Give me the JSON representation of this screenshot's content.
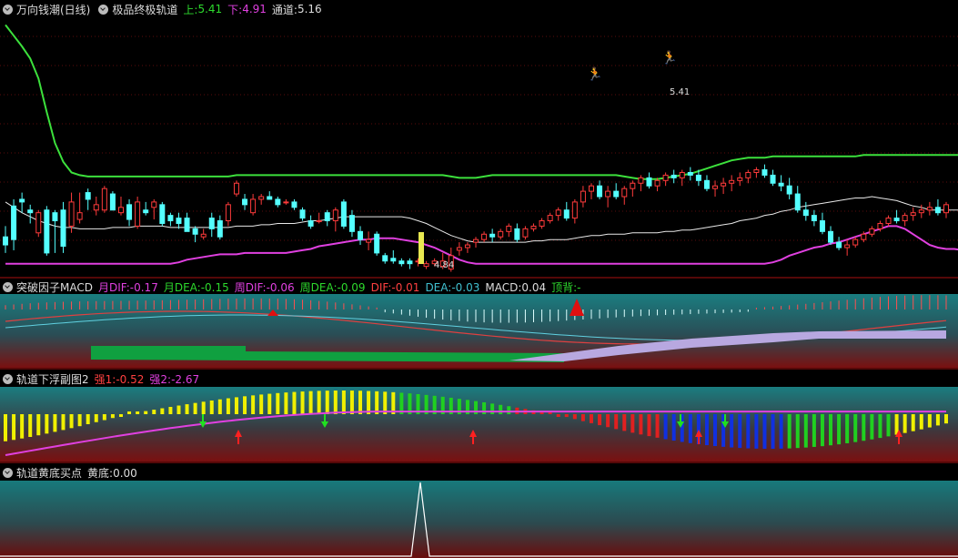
{
  "panel1": {
    "stock_title": "万向钱潮(日线)",
    "indicator_title": "极品终极轨道",
    "up_label": "上:",
    "up_value": "5.41",
    "down_label": "下:",
    "down_value": "4.91",
    "channel_label": "通道:",
    "channel_value": "5.16",
    "high_annotation": "5.41",
    "low_annotation": "4.84"
  },
  "panel2": {
    "title": "突破因子MACD",
    "items": [
      {
        "label": "月DIF:",
        "value": "-0.17",
        "color": "#e040e0"
      },
      {
        "label": "月DEA:",
        "value": "-0.15",
        "color": "#2dd92d"
      },
      {
        "label": "周DIF:",
        "value": "-0.06",
        "color": "#e040e0"
      },
      {
        "label": "周DEA:",
        "value": "-0.09",
        "color": "#2dd92d"
      },
      {
        "label": "DIF:",
        "value": "-0.01",
        "color": "#ff4040"
      },
      {
        "label": "DEA:",
        "value": "-0.03",
        "color": "#40c0d0"
      },
      {
        "label": "MACD:",
        "value": "0.04",
        "color": "#dddddd"
      },
      {
        "label": "顶背:",
        "value": "-",
        "color": "#2dd92d"
      }
    ]
  },
  "panel3": {
    "title": "轨道下浮副图2",
    "items": [
      {
        "label": "强1:",
        "value": "-0.52",
        "color": "#ff4040"
      },
      {
        "label": "强2:",
        "value": "-2.67",
        "color": "#e040e0"
      }
    ]
  },
  "panel4": {
    "title": "轨道黄底买点",
    "items": [
      {
        "label": "黄底:",
        "value": "0.00",
        "color": "#dddddd"
      }
    ]
  },
  "chart_data": {
    "type": "candlestick",
    "colors": {
      "up": "#ff3b3b",
      "down": "#54ffff",
      "upper_band": "#3ce03c",
      "lower_band": "#e040e0",
      "mid_line": "#e8e8e8"
    },
    "upper_band": [
      6.6,
      6.52,
      6.44,
      6.35,
      6.2,
      5.95,
      5.72,
      5.58,
      5.5,
      5.48,
      5.47,
      5.47,
      5.47,
      5.47,
      5.47,
      5.47,
      5.47,
      5.47,
      5.47,
      5.47,
      5.47,
      5.47,
      5.47,
      5.47,
      5.47,
      5.47,
      5.47,
      5.47,
      5.48,
      5.48,
      5.48,
      5.48,
      5.48,
      5.48,
      5.48,
      5.48,
      5.48,
      5.48,
      5.48,
      5.48,
      5.48,
      5.48,
      5.48,
      5.48,
      5.48,
      5.48,
      5.48,
      5.48,
      5.48,
      5.48,
      5.48,
      5.48,
      5.48,
      5.48,
      5.47,
      5.46,
      5.46,
      5.46,
      5.47,
      5.48,
      5.48,
      5.48,
      5.48,
      5.48,
      5.48,
      5.48,
      5.48,
      5.48,
      5.48,
      5.48,
      5.48,
      5.48,
      5.48,
      5.48,
      5.48,
      5.47,
      5.46,
      5.45,
      5.45,
      5.45,
      5.46,
      5.47,
      5.48,
      5.49,
      5.51,
      5.53,
      5.55,
      5.57,
      5.59,
      5.6,
      5.61,
      5.61,
      5.61,
      5.62,
      5.62,
      5.62,
      5.62,
      5.62,
      5.62,
      5.62,
      5.62,
      5.62,
      5.62,
      5.62,
      5.63,
      5.63,
      5.63,
      5.63,
      5.63,
      5.63,
      5.63,
      5.63,
      5.63,
      5.63,
      5.63,
      5.63,
      5.63,
      5.63,
      5.63,
      5.63,
      5.63,
      5.63,
      5.63,
      5.63,
      5.63
    ],
    "mid_line": [
      5.28,
      5.24,
      5.2,
      5.17,
      5.14,
      5.12,
      5.1,
      5.09,
      5.09,
      5.08,
      5.08,
      5.08,
      5.08,
      5.09,
      5.09,
      5.09,
      5.1,
      5.1,
      5.1,
      5.1,
      5.09,
      5.09,
      5.09,
      5.09,
      5.09,
      5.09,
      5.09,
      5.09,
      5.1,
      5.1,
      5.1,
      5.11,
      5.11,
      5.12,
      5.12,
      5.12,
      5.13,
      5.14,
      5.14,
      5.15,
      5.16,
      5.17,
      5.17,
      5.17,
      5.17,
      5.17,
      5.17,
      5.17,
      5.17,
      5.16,
      5.14,
      5.12,
      5.09,
      5.06,
      5.03,
      5.01,
      4.99,
      4.98,
      4.98,
      4.98,
      4.98,
      4.98,
      4.98,
      4.98,
      4.99,
      4.99,
      5.0,
      5.0,
      5.0,
      5.01,
      5.02,
      5.03,
      5.03,
      5.04,
      5.04,
      5.04,
      5.05,
      5.05,
      5.05,
      5.05,
      5.06,
      5.06,
      5.07,
      5.07,
      5.08,
      5.09,
      5.1,
      5.11,
      5.12,
      5.14,
      5.15,
      5.16,
      5.18,
      5.19,
      5.21,
      5.22,
      5.24,
      5.25,
      5.26,
      5.27,
      5.28,
      5.29,
      5.3,
      5.31,
      5.31,
      5.32,
      5.31,
      5.3,
      5.29,
      5.27,
      5.25,
      5.24,
      5.22,
      5.22,
      5.22,
      5.22,
      5.22,
      5.22,
      5.22,
      5.22,
      5.22,
      5.22,
      5.22,
      5.22,
      5.22
    ],
    "lower_band": [
      4.82,
      4.82,
      4.82,
      4.82,
      4.82,
      4.82,
      4.82,
      4.82,
      4.82,
      4.82,
      4.82,
      4.82,
      4.82,
      4.82,
      4.82,
      4.82,
      4.82,
      4.82,
      4.82,
      4.82,
      4.82,
      4.83,
      4.85,
      4.86,
      4.87,
      4.88,
      4.89,
      4.89,
      4.89,
      4.9,
      4.9,
      4.9,
      4.9,
      4.9,
      4.9,
      4.91,
      4.92,
      4.93,
      4.95,
      4.96,
      4.97,
      4.98,
      4.99,
      5.0,
      5.0,
      5.01,
      5.01,
      5.01,
      5.0,
      4.99,
      4.98,
      4.96,
      4.94,
      4.91,
      4.88,
      4.85,
      4.83,
      4.82,
      4.82,
      4.82,
      4.82,
      4.82,
      4.82,
      4.82,
      4.82,
      4.82,
      4.82,
      4.82,
      4.82,
      4.82,
      4.82,
      4.82,
      4.82,
      4.82,
      4.82,
      4.82,
      4.82,
      4.82,
      4.82,
      4.82,
      4.82,
      4.82,
      4.82,
      4.82,
      4.82,
      4.82,
      4.82,
      4.82,
      4.82,
      4.82,
      4.82,
      4.82,
      4.82,
      4.83,
      4.85,
      4.88,
      4.9,
      4.92,
      4.94,
      4.95,
      4.97,
      4.98,
      5.0,
      5.02,
      5.04,
      5.06,
      5.08,
      5.1,
      5.1,
      5.08,
      5.04,
      5.0,
      4.96,
      4.94,
      4.93,
      4.93,
      4.92,
      4.92,
      4.92,
      4.91,
      4.91,
      4.91,
      4.91,
      4.91,
      4.91
    ],
    "ohlc": [
      [
        5.02,
        5.1,
        4.9,
        4.96
      ],
      [
        5.25,
        5.3,
        4.92,
        5.0
      ],
      [
        5.3,
        5.35,
        5.2,
        5.28
      ],
      [
        5.22,
        5.26,
        5.12,
        5.2
      ],
      [
        5.05,
        5.22,
        5.02,
        5.2
      ],
      [
        5.22,
        5.25,
        4.88,
        4.9
      ],
      [
        5.2,
        5.22,
        4.9,
        5.14
      ],
      [
        5.22,
        5.28,
        4.9,
        4.95
      ],
      [
        5.1,
        5.35,
        5.05,
        5.28
      ],
      [
        5.15,
        5.35,
        5.12,
        5.2
      ],
      [
        5.35,
        5.38,
        5.22,
        5.3
      ],
      [
        5.22,
        5.32,
        5.18,
        5.26
      ],
      [
        5.22,
        5.4,
        5.2,
        5.38
      ],
      [
        5.34,
        5.36,
        5.22,
        5.22
      ],
      [
        5.2,
        5.32,
        5.18,
        5.24
      ],
      [
        5.26,
        5.3,
        5.1,
        5.15
      ],
      [
        5.1,
        5.32,
        5.08,
        5.28
      ],
      [
        5.22,
        5.28,
        5.18,
        5.2
      ],
      [
        5.24,
        5.3,
        5.15,
        5.28
      ],
      [
        5.26,
        5.28,
        5.1,
        5.12
      ],
      [
        5.18,
        5.2,
        5.1,
        5.14
      ],
      [
        5.16,
        5.2,
        5.08,
        5.12
      ],
      [
        5.16,
        5.2,
        5.06,
        5.06
      ],
      [
        5.08,
        5.1,
        4.98,
        5.04
      ],
      [
        5.02,
        5.08,
        5.0,
        5.04
      ],
      [
        5.16,
        5.2,
        5.02,
        5.08
      ],
      [
        5.14,
        5.18,
        5.0,
        5.02
      ],
      [
        5.14,
        5.28,
        5.1,
        5.26
      ],
      [
        5.34,
        5.44,
        5.32,
        5.42
      ],
      [
        5.3,
        5.34,
        5.22,
        5.26
      ],
      [
        5.2,
        5.34,
        5.18,
        5.3
      ],
      [
        5.3,
        5.34,
        5.26,
        5.32
      ],
      [
        5.32,
        5.36,
        5.3,
        5.3
      ],
      [
        5.3,
        5.32,
        5.24,
        5.26
      ],
      [
        5.28,
        5.3,
        5.26,
        5.28
      ],
      [
        5.28,
        5.3,
        5.22,
        5.24
      ],
      [
        5.22,
        5.24,
        5.14,
        5.16
      ],
      [
        5.14,
        5.18,
        5.08,
        5.1
      ],
      [
        5.14,
        5.2,
        5.12,
        5.14
      ],
      [
        5.2,
        5.22,
        5.1,
        5.14
      ],
      [
        5.14,
        5.24,
        5.06,
        5.22
      ],
      [
        5.28,
        5.3,
        5.08,
        5.1
      ],
      [
        5.18,
        5.22,
        5.02,
        5.06
      ],
      [
        5.06,
        5.1,
        4.96,
        5.0
      ],
      [
        4.98,
        5.06,
        4.92,
        5.0
      ],
      [
        5.04,
        5.06,
        4.88,
        4.9
      ],
      [
        4.88,
        4.9,
        4.82,
        4.84
      ],
      [
        4.86,
        4.92,
        4.82,
        4.84
      ],
      [
        4.84,
        4.86,
        4.8,
        4.82
      ],
      [
        4.84,
        4.86,
        4.78,
        4.82
      ],
      [
        4.84,
        4.86,
        4.8,
        4.84
      ],
      [
        4.8,
        4.84,
        4.78,
        4.82
      ],
      [
        4.82,
        4.86,
        4.8,
        4.84
      ],
      [
        4.8,
        4.9,
        4.78,
        4.84
      ],
      [
        4.78,
        4.94,
        4.76,
        4.88
      ],
      [
        4.92,
        4.98,
        4.88,
        4.94
      ],
      [
        4.94,
        4.98,
        4.9,
        4.96
      ],
      [
        4.98,
        5.02,
        4.94,
        5.0
      ],
      [
        5.0,
        5.06,
        4.98,
        5.04
      ],
      [
        5.04,
        5.08,
        4.98,
        5.02
      ],
      [
        5.02,
        5.08,
        5.0,
        5.06
      ],
      [
        5.06,
        5.12,
        5.02,
        5.1
      ],
      [
        5.08,
        5.12,
        4.98,
        5.0
      ],
      [
        5.02,
        5.1,
        5.0,
        5.08
      ],
      [
        5.08,
        5.12,
        5.06,
        5.1
      ],
      [
        5.1,
        5.16,
        5.08,
        5.14
      ],
      [
        5.14,
        5.2,
        5.12,
        5.18
      ],
      [
        5.18,
        5.24,
        5.14,
        5.22
      ],
      [
        5.22,
        5.28,
        5.14,
        5.16
      ],
      [
        5.16,
        5.3,
        5.12,
        5.28
      ],
      [
        5.28,
        5.4,
        5.24,
        5.36
      ],
      [
        5.36,
        5.42,
        5.3,
        5.4
      ],
      [
        5.4,
        5.44,
        5.3,
        5.32
      ],
      [
        5.32,
        5.4,
        5.24,
        5.36
      ],
      [
        5.36,
        5.42,
        5.3,
        5.32
      ],
      [
        5.32,
        5.4,
        5.26,
        5.38
      ],
      [
        5.38,
        5.44,
        5.32,
        5.42
      ],
      [
        5.42,
        5.48,
        5.36,
        5.46
      ],
      [
        5.46,
        5.5,
        5.38,
        5.4
      ],
      [
        5.4,
        5.46,
        5.36,
        5.44
      ],
      [
        5.44,
        5.5,
        5.4,
        5.48
      ],
      [
        5.48,
        5.52,
        5.42,
        5.46
      ],
      [
        5.46,
        5.52,
        5.4,
        5.5
      ],
      [
        5.5,
        5.54,
        5.44,
        5.48
      ],
      [
        5.48,
        5.52,
        5.4,
        5.44
      ],
      [
        5.44,
        5.48,
        5.36,
        5.38
      ],
      [
        5.38,
        5.44,
        5.32,
        5.4
      ],
      [
        5.4,
        5.46,
        5.34,
        5.42
      ],
      [
        5.42,
        5.48,
        5.36,
        5.44
      ],
      [
        5.44,
        5.5,
        5.4,
        5.46
      ],
      [
        5.46,
        5.52,
        5.42,
        5.5
      ],
      [
        5.5,
        5.54,
        5.46,
        5.52
      ],
      [
        5.52,
        5.56,
        5.46,
        5.48
      ],
      [
        5.48,
        5.52,
        5.4,
        5.42
      ],
      [
        5.42,
        5.48,
        5.36,
        5.4
      ],
      [
        5.4,
        5.46,
        5.3,
        5.34
      ],
      [
        5.34,
        5.4,
        5.2,
        5.22
      ],
      [
        5.22,
        5.28,
        5.14,
        5.18
      ],
      [
        5.18,
        5.22,
        5.1,
        5.14
      ],
      [
        5.14,
        5.2,
        5.04,
        5.06
      ],
      [
        5.06,
        5.1,
        4.96,
        4.98
      ],
      [
        4.98,
        5.02,
        4.92,
        4.94
      ],
      [
        4.94,
        5.0,
        4.88,
        4.96
      ],
      [
        4.96,
        5.02,
        4.94,
        5.0
      ],
      [
        5.0,
        5.06,
        4.98,
        5.04
      ],
      [
        5.04,
        5.1,
        5.02,
        5.08
      ],
      [
        5.08,
        5.14,
        5.06,
        5.12
      ],
      [
        5.12,
        5.18,
        5.1,
        5.16
      ],
      [
        5.16,
        5.22,
        5.12,
        5.14
      ],
      [
        5.14,
        5.2,
        5.1,
        5.18
      ],
      [
        5.18,
        5.24,
        5.14,
        5.2
      ],
      [
        5.2,
        5.26,
        5.16,
        5.22
      ],
      [
        5.22,
        5.28,
        5.18,
        5.24
      ],
      [
        5.24,
        5.3,
        5.18,
        5.2
      ],
      [
        5.2,
        5.28,
        5.16,
        5.26
      ]
    ],
    "upper_band_label": "上",
    "lower_band_label": "下",
    "channel_label": "通道"
  }
}
